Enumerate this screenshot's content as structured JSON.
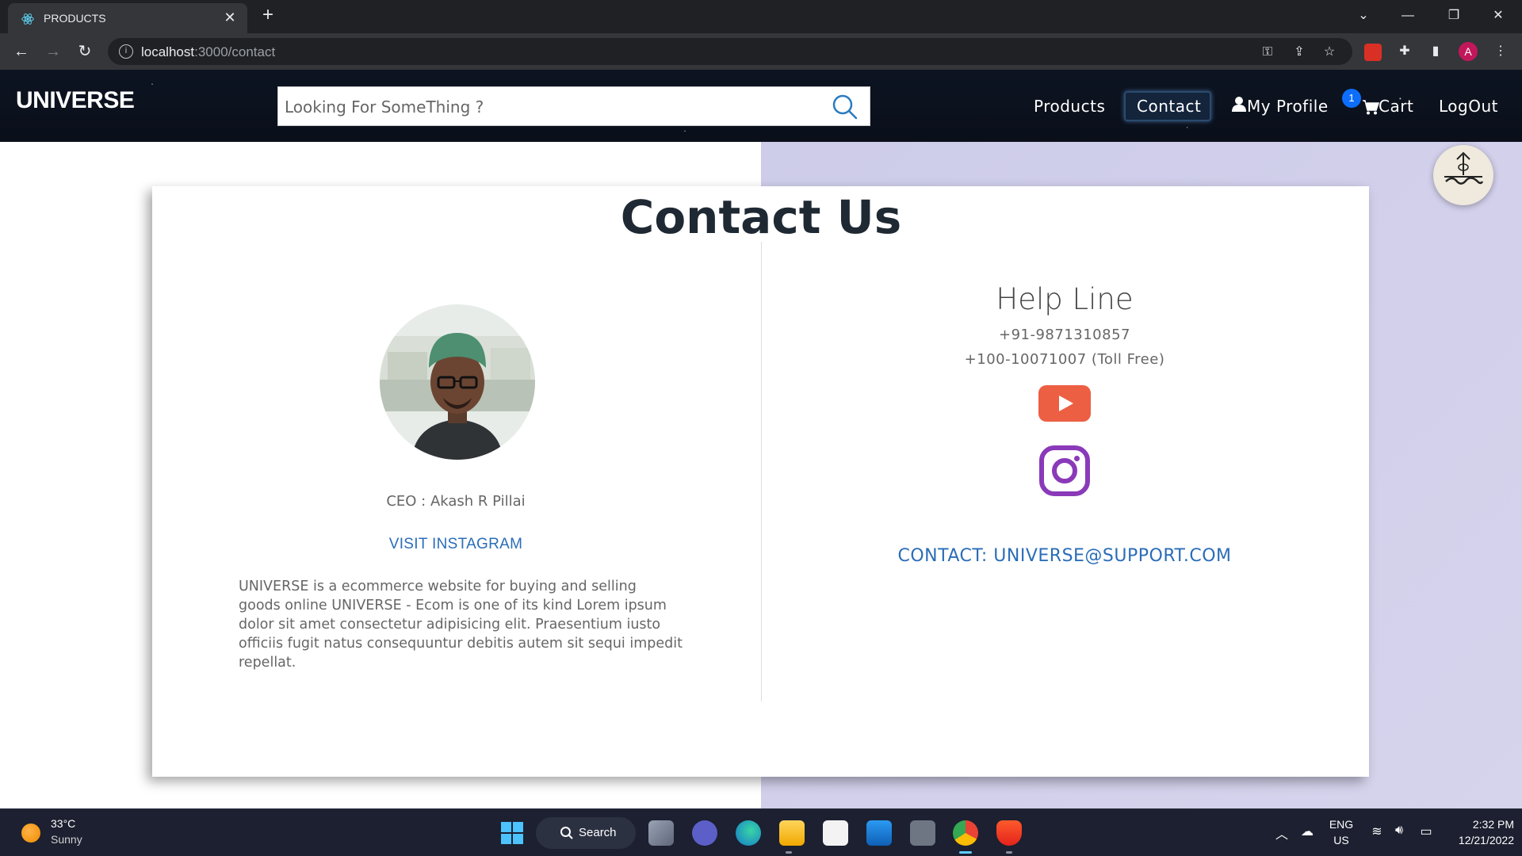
{
  "browser": {
    "tab_title": "PRODUCTS",
    "url_host": "localhost",
    "url_path": ":3000/contact"
  },
  "site": {
    "logo": "UNIVERSE",
    "search_placeholder": "Looking For SomeThing ?",
    "nav": {
      "products": "Products",
      "contact": "Contact",
      "profile": "My Profile",
      "cart": "Cart",
      "cart_count": "1",
      "logout": "LogOut"
    },
    "active_nav": "contact"
  },
  "contact": {
    "title": "Contact Us",
    "ceo": "CEO : Akash R Pillai",
    "instagram_link": "VISIT INSTAGRAM",
    "about": "UNIVERSE is a ecommerce website for buying and selling goods online UNIVERSE - Ecom is one of its kind Lorem ipsum dolor sit amet consectetur adipisicing elit. Praesentium iusto officiis fugit natus consequuntur debitis autem sit sequi impedit repellat.",
    "help_line_title": "Help Line",
    "phone_1": "+91-9871310857",
    "phone_2": "+100-10071007 (Toll Free)",
    "email": "CONTACT: UNIVERSE@SUPPORT.COM"
  },
  "taskbar": {
    "temperature": "33°C",
    "condition": "Sunny",
    "search_label": "Search",
    "language": "ENG",
    "region": "US",
    "time": "2:32 PM",
    "date": "12/21/2022"
  },
  "colors": {
    "link_blue": "#2a6db8",
    "youtube_red": "#ec5f43",
    "instagram_purple": "#8a3ab9",
    "right_bg": "#cdcce9"
  }
}
